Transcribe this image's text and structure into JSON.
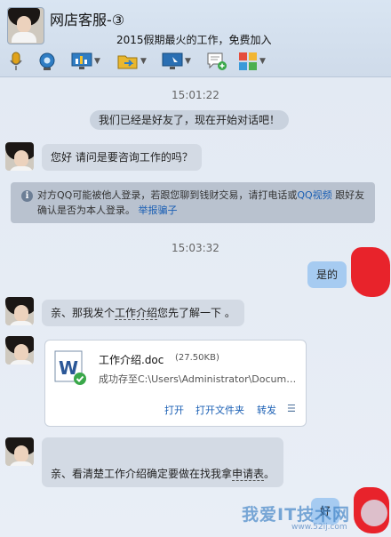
{
  "window": {
    "title": "网店客服-③",
    "signature": "2015假期最火的工作，免费加入"
  },
  "toolbar": [
    "microphone-icon",
    "camera-icon",
    "screen-share-icon",
    "file-transfer-icon",
    "remote-desktop-icon",
    "message-edit-icon",
    "apps-icon"
  ],
  "chat": {
    "time1": "15:01:22",
    "system_msg": "我们已经是好友了，现在开始对话吧！",
    "msg1": "您好 请问是要咨询工作的吗？",
    "warning_pre": "对方QQ可能被他人登录，若跟您聊到钱财交易，请打电话或",
    "warning_link1": "QQ视频",
    "warning_mid": "跟好友确认是否为本人登录。",
    "warning_link2": "举报骗子",
    "time2": "15:03:32",
    "reply1": "是的",
    "msg2_a": "亲、那我发个",
    "msg2_b": "工作介绍",
    "msg2_c": "您先了解一下 。",
    "file": {
      "name": "工作介绍.doc",
      "size": "(27.50KB)",
      "status": "成功存至C:\\Users\\Administrator\\Documents\\Tencent Files",
      "actions": [
        "打开",
        "打开文件夹",
        "转发"
      ]
    },
    "msg3_a": "亲、看清楚工作介绍确定要做在找我拿",
    "msg3_b": "申请表",
    "msg3_c": "。",
    "reply2": "好"
  },
  "watermark": {
    "text": "我爱IT技术网",
    "url": "www.52ij.com"
  },
  "colors": {
    "my_bubble": "#a6cbf1",
    "their_bubble": "#d3dae4",
    "link": "#1a5fb4",
    "redaction": "#e8232b"
  }
}
